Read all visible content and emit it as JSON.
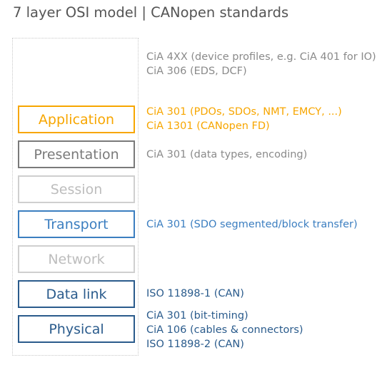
{
  "title": "7 layer OSI model | CANopen standards",
  "colors": {
    "orange": "#f7a600",
    "gray_dark": "#7a7a7a",
    "gray_light": "#bdbdbd",
    "blue_light": "#3b7ec0",
    "blue_dark": "#2a5b8c",
    "notes_gray": "#8a8a8a"
  },
  "top_notes": [
    "CiA 4XX (device profiles, e.g. CiA 401 for IO)",
    "CiA 306 (EDS, DCF)"
  ],
  "layers": [
    {
      "label": "Application",
      "notes": [
        "CiA 301 (PDOs, SDOs, NMT, EMCY, ...)",
        "CiA 1301 (CANopen FD)"
      ]
    },
    {
      "label": "Presentation",
      "notes": [
        "CiA 301 (data types, encoding)"
      ]
    },
    {
      "label": "Session",
      "notes": []
    },
    {
      "label": "Transport",
      "notes": [
        "CiA 301 (SDO segmented/block transfer)"
      ]
    },
    {
      "label": "Network",
      "notes": []
    },
    {
      "label": "Data link",
      "notes": [
        "ISO 11898-1 (CAN)"
      ]
    },
    {
      "label": "Physical",
      "notes": [
        "CiA 301 (bit-timing)",
        "CiA 106 (cables & connectors)",
        "ISO 11898-2 (CAN)"
      ]
    }
  ]
}
